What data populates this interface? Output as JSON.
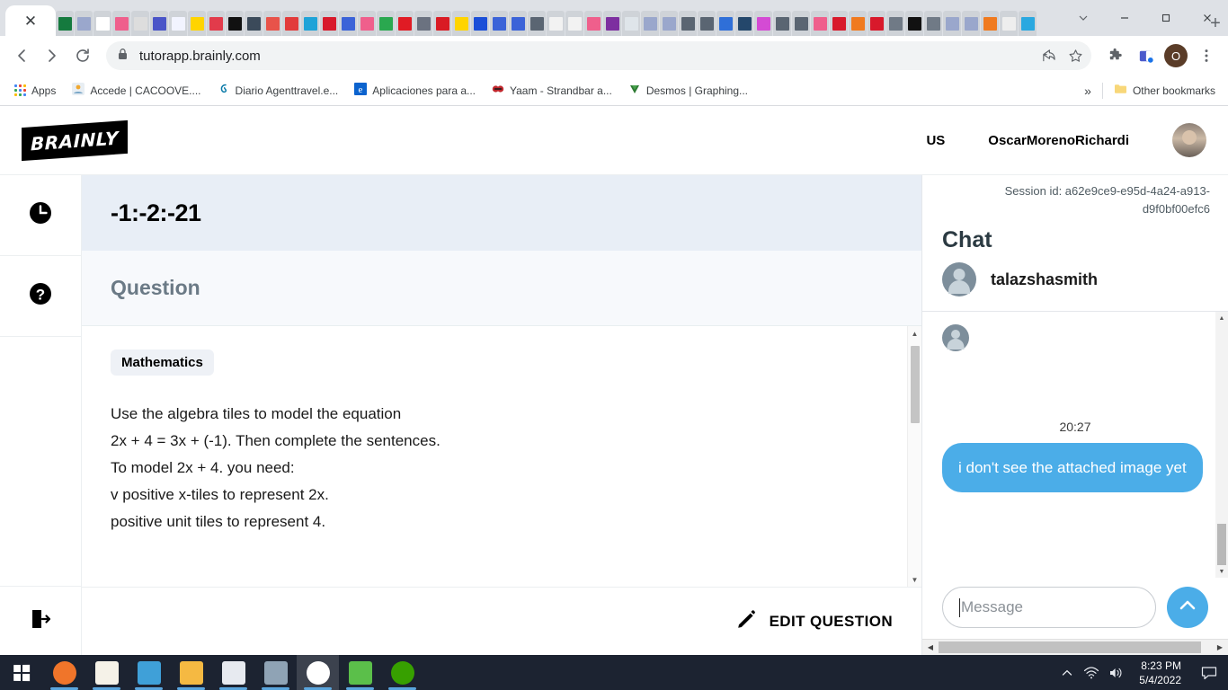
{
  "browser": {
    "active_tab": {
      "close_icon": "close-icon"
    },
    "url": "tutorapp.brainly.com",
    "lock_icon": "lock-icon",
    "new_tab_label": "+",
    "window_controls": {
      "tab_search": "chevron-down-icon",
      "minimize": "minimize-icon",
      "maximize": "maximize-icon",
      "close": "close-icon"
    },
    "toolbar_icons": [
      "back-icon",
      "forward-icon",
      "reload-icon",
      "share-icon",
      "star-icon",
      "extensions-icon",
      "sidepanel-icon",
      "profile-avatar",
      "more-menu-icon"
    ],
    "profile_initial": "O",
    "tab_favicons": [
      "#157a3e",
      "#9aa7cc",
      "#ffffff",
      "#ef5f8c",
      "#dddddd",
      "#4a55c8",
      "#f2f4ff",
      "#ffd400",
      "#e23b4b",
      "#111111",
      "#3b4a5a",
      "#e8534a",
      "#e23b3b",
      "#1fa3d8",
      "#d8192b",
      "#3b63d8",
      "#ef5f8c",
      "#2aa84f",
      "#e01b24",
      "#6b7280",
      "#d91b24",
      "#ffd400",
      "#1b4fd8",
      "#3b63d8",
      "#3b63d8",
      "#5a6572",
      "#f2f2f2",
      "#f2f2f2",
      "#ef5f8c",
      "#7d2fa0",
      "#dfe5ea",
      "#9aa7cc",
      "#9aa7cc",
      "#5a6572",
      "#5a6572",
      "#2f6fd8",
      "#24476b",
      "#d44bd4",
      "#5a6572",
      "#5a6572",
      "#ef5f8c",
      "#d8192b",
      "#f07a1f",
      "#d8192b",
      "#707a86",
      "#111111",
      "#707a86",
      "#9aa7cc",
      "#9aa7cc",
      "#f07a1f",
      "#eeeeee",
      "#2aa8e0"
    ],
    "bookmarks": [
      {
        "label": "Apps",
        "icon": "apps-grid-icon"
      },
      {
        "label": "Accede | CACOOVE....",
        "icon": "site-icon"
      },
      {
        "label": "Diario Agenttravel.e...",
        "icon": "site-icon"
      },
      {
        "label": "Aplicaciones para a...",
        "icon": "edge-icon"
      },
      {
        "label": "Yaam - Strandbar a...",
        "icon": "site-icon"
      },
      {
        "label": "Desmos | Graphing...",
        "icon": "desmos-icon"
      }
    ],
    "bookmarks_overflow": "»",
    "other_bookmarks": {
      "label": "Other bookmarks",
      "icon": "folder-icon"
    }
  },
  "app": {
    "logo_text": "BRAINLY",
    "header": {
      "country": "US",
      "username": "OscarMorenoRichardi",
      "avatar": "user-avatar"
    },
    "rail": [
      {
        "icon": "clock-icon",
        "name": "history"
      },
      {
        "icon": "question-mark-icon",
        "name": "help"
      }
    ],
    "rail_bottom": {
      "icon": "logout-icon",
      "name": "logout"
    },
    "question": {
      "title": "-1:-2:-21",
      "section_heading": "Question",
      "subject": "Mathematics",
      "lines": [
        "Use the algebra tiles to model the equation",
        "2x + 4 = 3x + (-1). Then complete the sentences.",
        "To model 2x + 4. you need:",
        "v positive x-tiles to represent 2x.",
        "positive unit tiles to represent 4."
      ],
      "edit_button": "EDIT QUESTION",
      "edit_icon": "pencil-icon"
    },
    "chat": {
      "session_id": "Session id: a62e9ce9-e95d-4a24-a913-d9f0bf00efc6",
      "heading": "Chat",
      "participant": "talazshasmith",
      "participant_avatar": "user-avatar",
      "messages": [
        {
          "avatar": "user-avatar",
          "time": "20:27",
          "text": "i don't see the attached image yet",
          "outgoing": true
        }
      ],
      "input_placeholder": "Message",
      "input_value": "",
      "send_icon": "chevron-up-icon",
      "bubble_color": "#4bade8"
    }
  },
  "taskbar": {
    "start_icon": "windows-start-icon",
    "apps": [
      {
        "name": "firefox",
        "color": "#f0752a"
      },
      {
        "name": "notes",
        "color": "#f5f2e8"
      },
      {
        "name": "media-player",
        "color": "#3fa0d8"
      },
      {
        "name": "file-explorer",
        "color": "#f5b942"
      },
      {
        "name": "paint",
        "color": "#e7eaf0"
      },
      {
        "name": "calculator",
        "color": "#8fa3b5"
      },
      {
        "name": "chrome",
        "color": "#ffffff"
      },
      {
        "name": "office-lens",
        "color": "#5bbf4a"
      },
      {
        "name": "upwork",
        "color": "#37a000"
      }
    ],
    "tray": {
      "chevron": "chevron-up-icon",
      "wifi": "wifi-icon",
      "volume": "volume-icon",
      "notifications": "notification-icon"
    },
    "time": "8:23 PM",
    "date": "5/4/2022"
  }
}
